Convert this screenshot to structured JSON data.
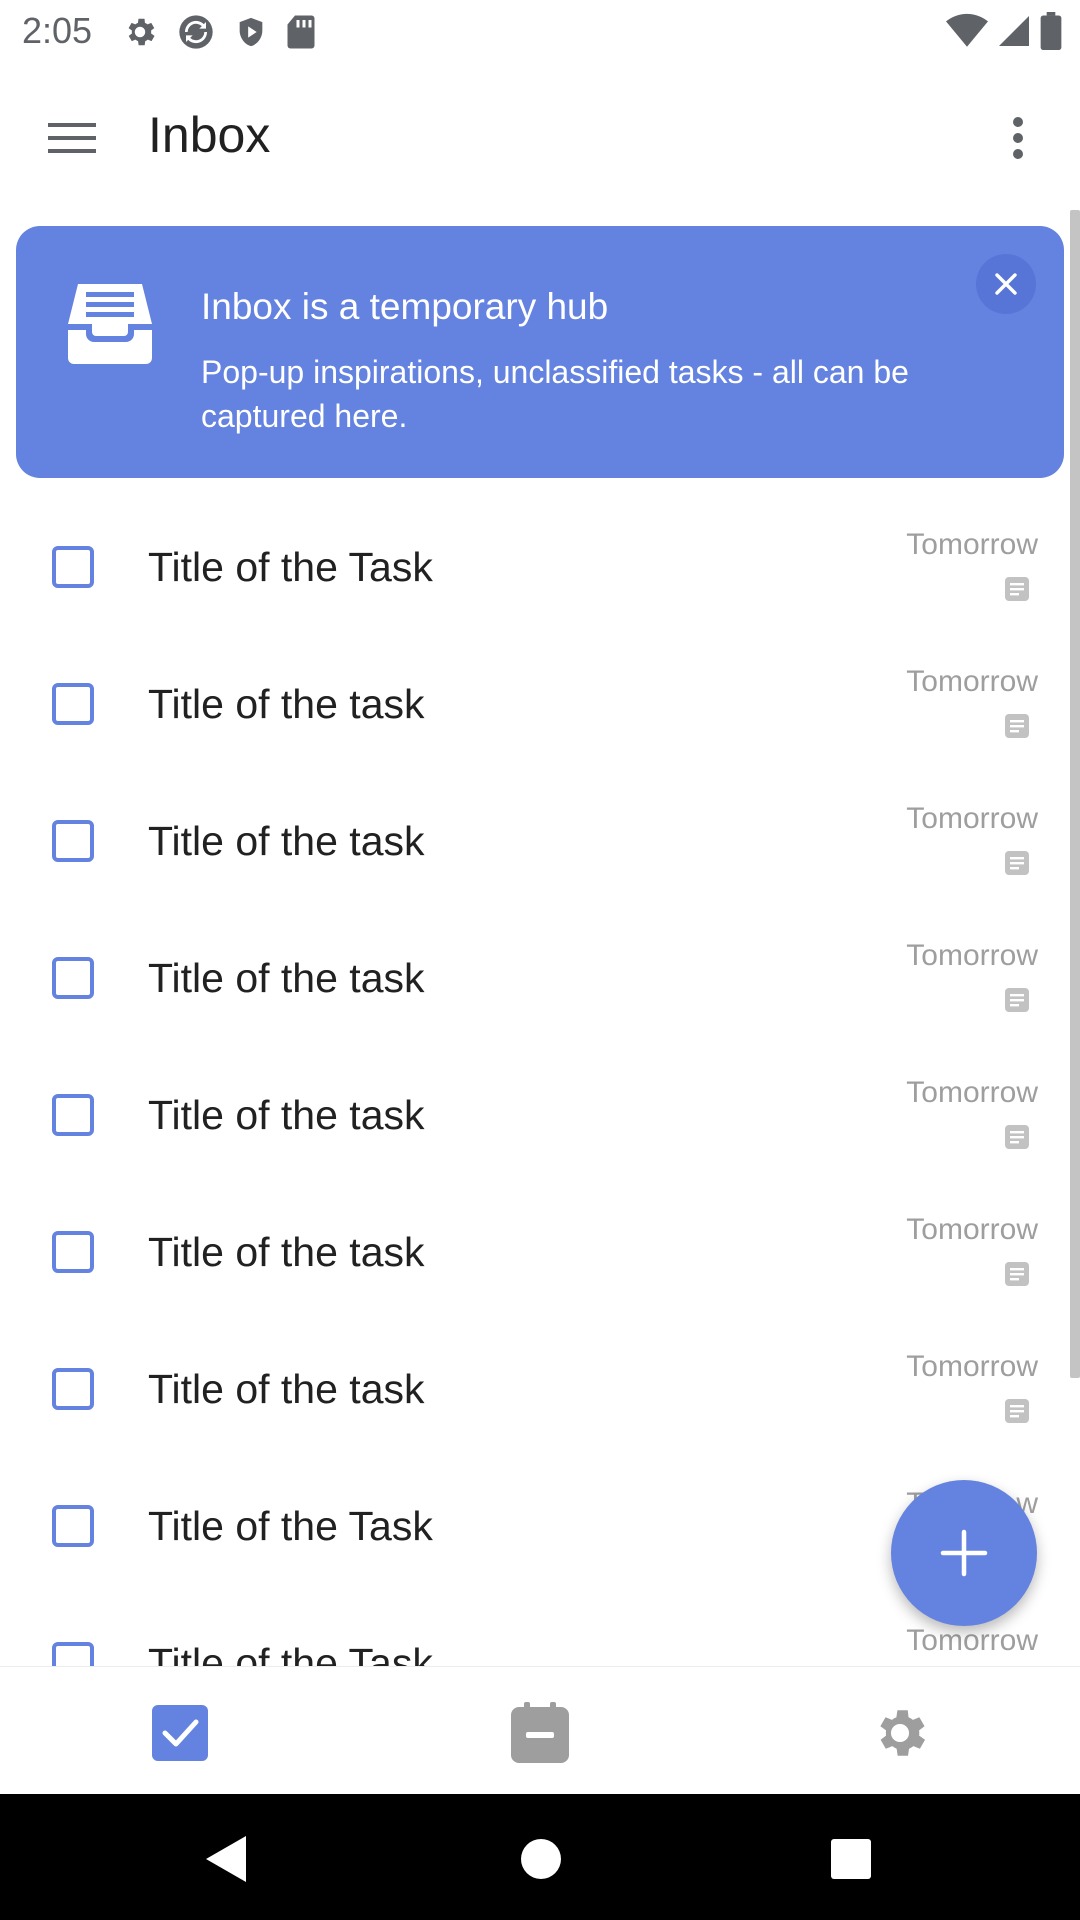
{
  "status_bar": {
    "time": "2:05",
    "left_icons": [
      "gear-icon",
      "sync-icon",
      "shield-play-icon",
      "sd-card-icon"
    ],
    "right_icons": [
      "wifi-icon",
      "signal-icon",
      "battery-icon"
    ]
  },
  "app_bar": {
    "title": "Inbox",
    "menu_icon": "hamburger-menu-icon",
    "more_icon": "more-vertical-icon"
  },
  "banner": {
    "title": "Inbox is a temporary hub",
    "body": "Pop-up inspirations, unclassified tasks - all can be captured here.",
    "icon": "inbox-tray-icon",
    "close_icon": "close-icon",
    "color": "#6482e0"
  },
  "tasks": [
    {
      "title": "Title of the Task",
      "date": "Tomorrow",
      "has_note": true
    },
    {
      "title": "Title of the task",
      "date": "Tomorrow",
      "has_note": true
    },
    {
      "title": "Title of the task",
      "date": "Tomorrow",
      "has_note": true
    },
    {
      "title": "Title of the task",
      "date": "Tomorrow",
      "has_note": true
    },
    {
      "title": "Title of the task",
      "date": "Tomorrow",
      "has_note": true
    },
    {
      "title": "Title of the task",
      "date": "Tomorrow",
      "has_note": true
    },
    {
      "title": "Title of the task",
      "date": "Tomorrow",
      "has_note": true
    },
    {
      "title": "Title of the Task",
      "date": "Tomorrow",
      "has_note": false
    },
    {
      "title": "Title of the Task",
      "date": "Tomorrow",
      "has_note": false
    }
  ],
  "fab": {
    "icon": "plus-icon"
  },
  "bottom_nav": {
    "items": [
      {
        "icon": "checkbox-tasks-icon",
        "active": true
      },
      {
        "icon": "calendar-icon",
        "active": false
      },
      {
        "icon": "settings-icon",
        "active": false
      }
    ]
  },
  "system_nav": {
    "icons": [
      "back-icon",
      "home-icon",
      "recents-icon"
    ]
  },
  "colors": {
    "accent": "#6482e0",
    "text_primary": "#212121",
    "text_secondary": "#9e9e9e",
    "icon_grey": "#9e9e9e"
  }
}
